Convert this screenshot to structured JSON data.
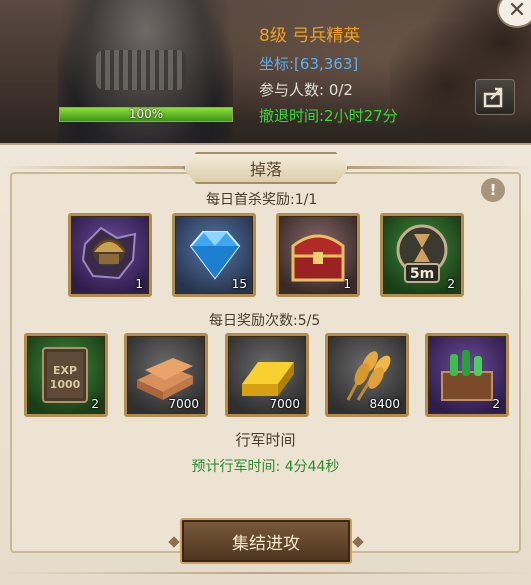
{
  "header": {
    "level_name": "8级 弓兵精英",
    "coords": "坐标:[63,363]",
    "participants": "参与人数: 0/2",
    "retreat_time": "撤退时间:2小时27分",
    "hp_label": "100%",
    "hp_fraction": 1.0
  },
  "panel": {
    "title": "掉落",
    "first_kill_label": "每日首杀奖励:1/1",
    "daily_label": "每日奖励次数:5/5",
    "march_label": "行军时间",
    "march_time": "预计行军时间: 4分44秒",
    "rally_button": "集结进攻"
  },
  "first_kill_items": [
    {
      "icon": "helmet-puzzle-icon",
      "count": "1"
    },
    {
      "icon": "blue-diamond-icon",
      "count": "15"
    },
    {
      "icon": "treasure-chest-icon",
      "count": "1"
    },
    {
      "icon": "speedup-5m-icon",
      "count": "2",
      "badge": "5m"
    }
  ],
  "daily_items": [
    {
      "icon": "exp-book-icon",
      "count": "2",
      "badge": "EXP 1000"
    },
    {
      "icon": "wood-icon",
      "count": "7000"
    },
    {
      "icon": "gold-bar-icon",
      "count": "7000"
    },
    {
      "icon": "wheat-icon",
      "count": "8400"
    },
    {
      "icon": "potion-chest-icon",
      "count": "2"
    }
  ],
  "colors": {
    "level_name": "#f0a020",
    "coords": "#5ab0f0",
    "retreat": "#38d838",
    "march_time": "#2f8a2f",
    "item_border": "#b08c4e"
  }
}
